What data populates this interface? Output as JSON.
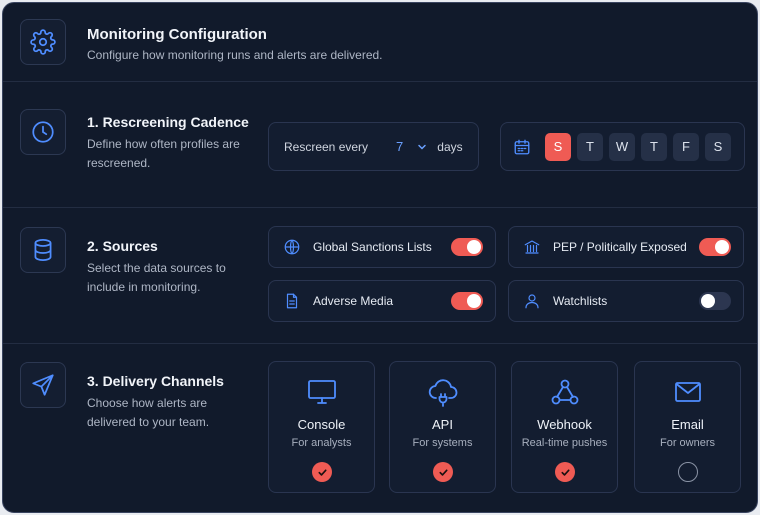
{
  "header": {
    "title": "Monitoring Configuration",
    "subtitle": "Configure how monitoring runs and alerts are delivered."
  },
  "cadence": {
    "title": "1. Rescreening Cadence",
    "desc_line1": "Define how often profiles are",
    "desc_line2": "rescreened.",
    "rescreen_label": "Rescreen every",
    "rescreen_value": "7",
    "rescreen_unit": "days",
    "days": [
      {
        "label": "S",
        "selected": true
      },
      {
        "label": "T",
        "selected": false
      },
      {
        "label": "W",
        "selected": false
      },
      {
        "label": "T",
        "selected": false
      },
      {
        "label": "F",
        "selected": false
      },
      {
        "label": "S",
        "selected": false
      }
    ]
  },
  "sources": {
    "title": "2. Sources",
    "desc_line1": "Select the data sources to",
    "desc_line2": "include in monitoring.",
    "items": [
      {
        "label": "Global Sanctions Lists",
        "enabled": true,
        "icon": "globe-icon"
      },
      {
        "label": "PEP / Politically Exposed",
        "enabled": true,
        "icon": "building-icon"
      },
      {
        "label": "Adverse Media",
        "enabled": true,
        "icon": "document-icon"
      },
      {
        "label": "Watchlists",
        "enabled": false,
        "icon": "user-icon"
      }
    ]
  },
  "delivery": {
    "title": "3. Delivery Channels",
    "desc_line1": "Choose how alerts are",
    "desc_line2": "delivered to your team.",
    "channels": [
      {
        "label": "Console",
        "sub": "For analysts",
        "checked": true,
        "icon": "monitor-icon"
      },
      {
        "label": "API",
        "sub": "For systems",
        "checked": true,
        "icon": "cloud-plug-icon"
      },
      {
        "label": "Webhook",
        "sub": "Real-time pushes",
        "checked": true,
        "icon": "webhook-icon"
      },
      {
        "label": "Email",
        "sub": "For owners",
        "checked": false,
        "icon": "mail-icon"
      }
    ]
  },
  "colors": {
    "accent": "#ef5b54",
    "icon_blue": "#4f8dff",
    "background": "#111a2b"
  }
}
